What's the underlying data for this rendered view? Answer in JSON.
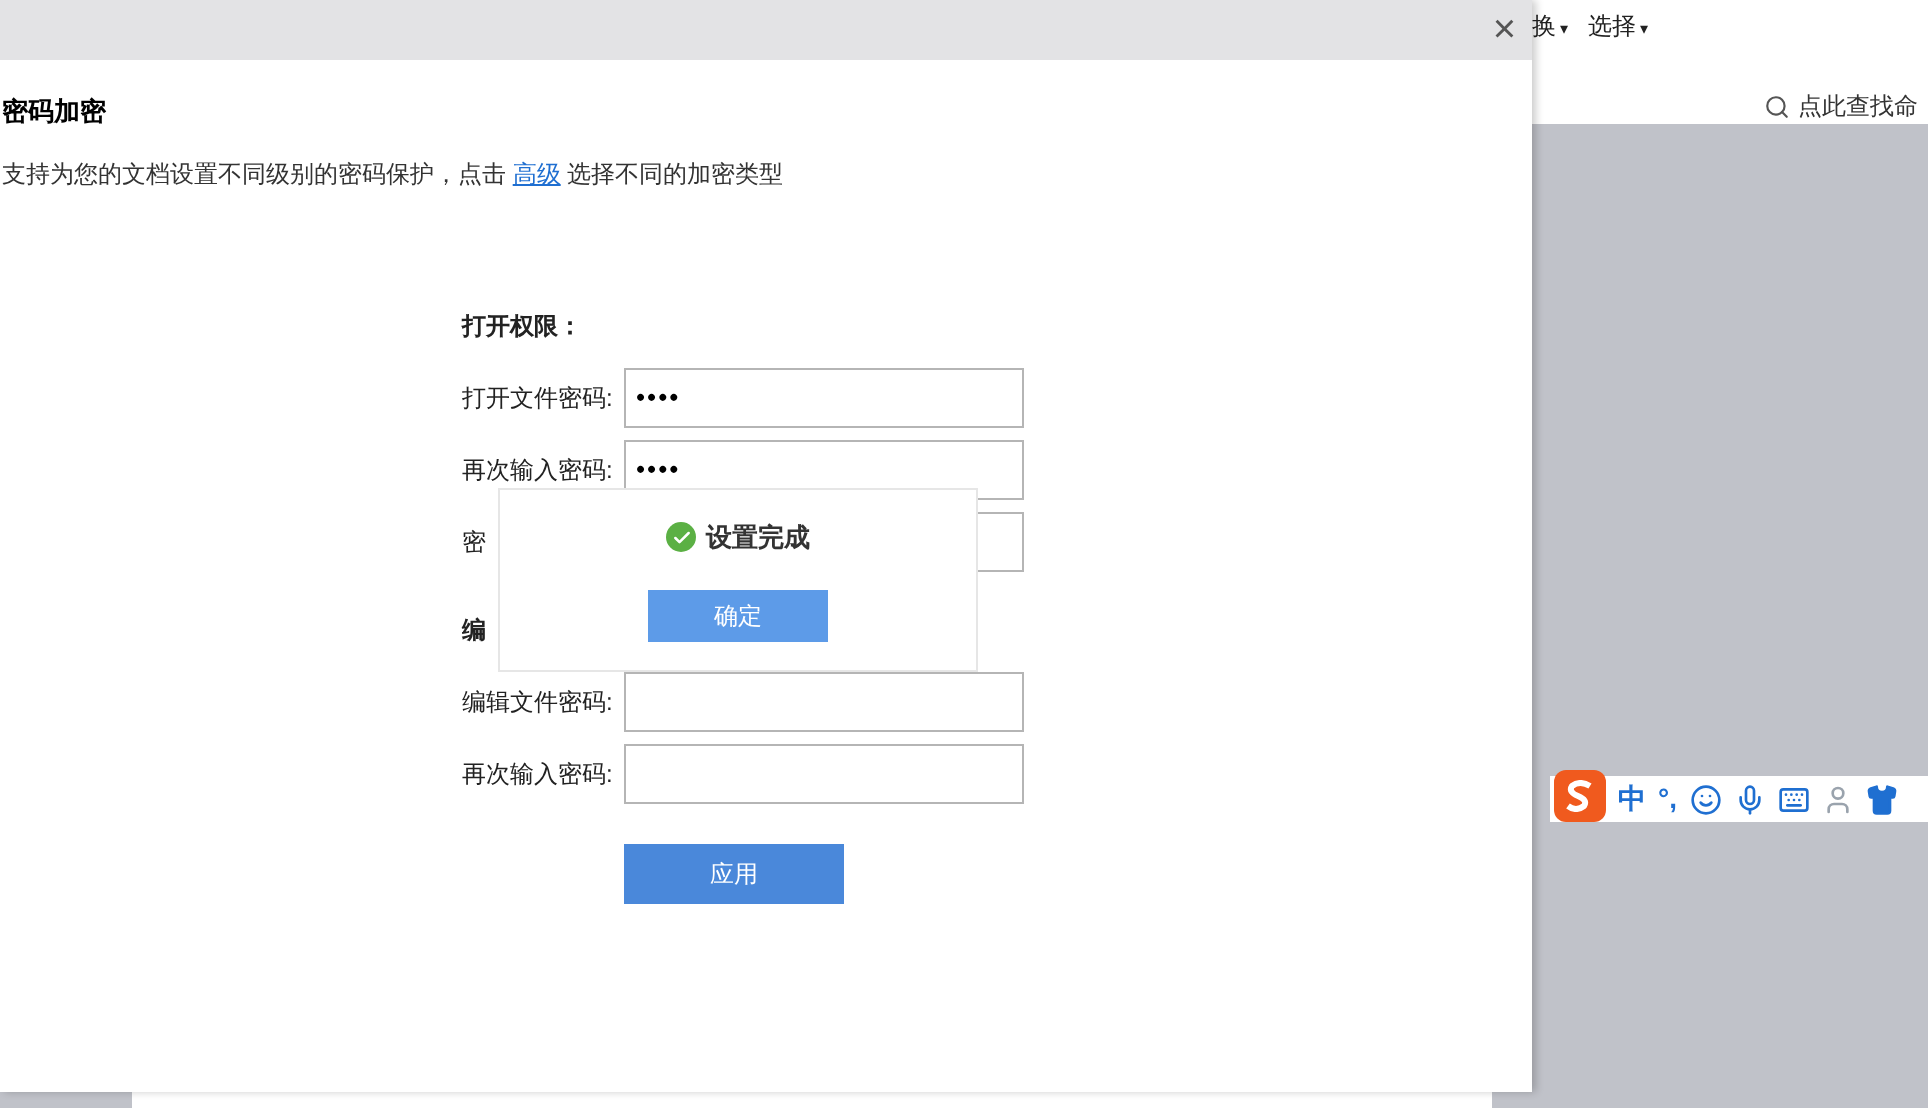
{
  "background_app": {
    "menu": [
      {
        "label": "换",
        "caret": "▾"
      },
      {
        "label": "选择",
        "caret": "▾"
      }
    ],
    "search": {
      "placeholder": "点此查找命"
    }
  },
  "dialog": {
    "close": "×",
    "title": "密码加密",
    "description": {
      "before": "支持为您的文档设置不同级别的密码保护，点击",
      "link": "高级",
      "after": "选择不同的加密类型"
    },
    "open_section": {
      "heading": "打开权限：",
      "fields": [
        {
          "label": "打开文件密码:",
          "value": "••••"
        },
        {
          "label": "再次输入密码:",
          "value": "••••"
        },
        {
          "label": "密"
        }
      ]
    },
    "edit_section": {
      "heading": "编",
      "fields": [
        {
          "label": "编辑文件密码:"
        },
        {
          "label": "再次输入密码:"
        }
      ]
    },
    "apply_button": "应用"
  },
  "popup": {
    "message": "设置完成",
    "ok_button": "确定"
  },
  "ime_bar": {
    "items": [
      {
        "kind": "text",
        "text": "中"
      },
      {
        "kind": "text",
        "text": "°,"
      },
      {
        "kind": "smile"
      },
      {
        "kind": "mic"
      },
      {
        "kind": "keyboard"
      },
      {
        "kind": "user"
      },
      {
        "kind": "shirt"
      }
    ]
  }
}
